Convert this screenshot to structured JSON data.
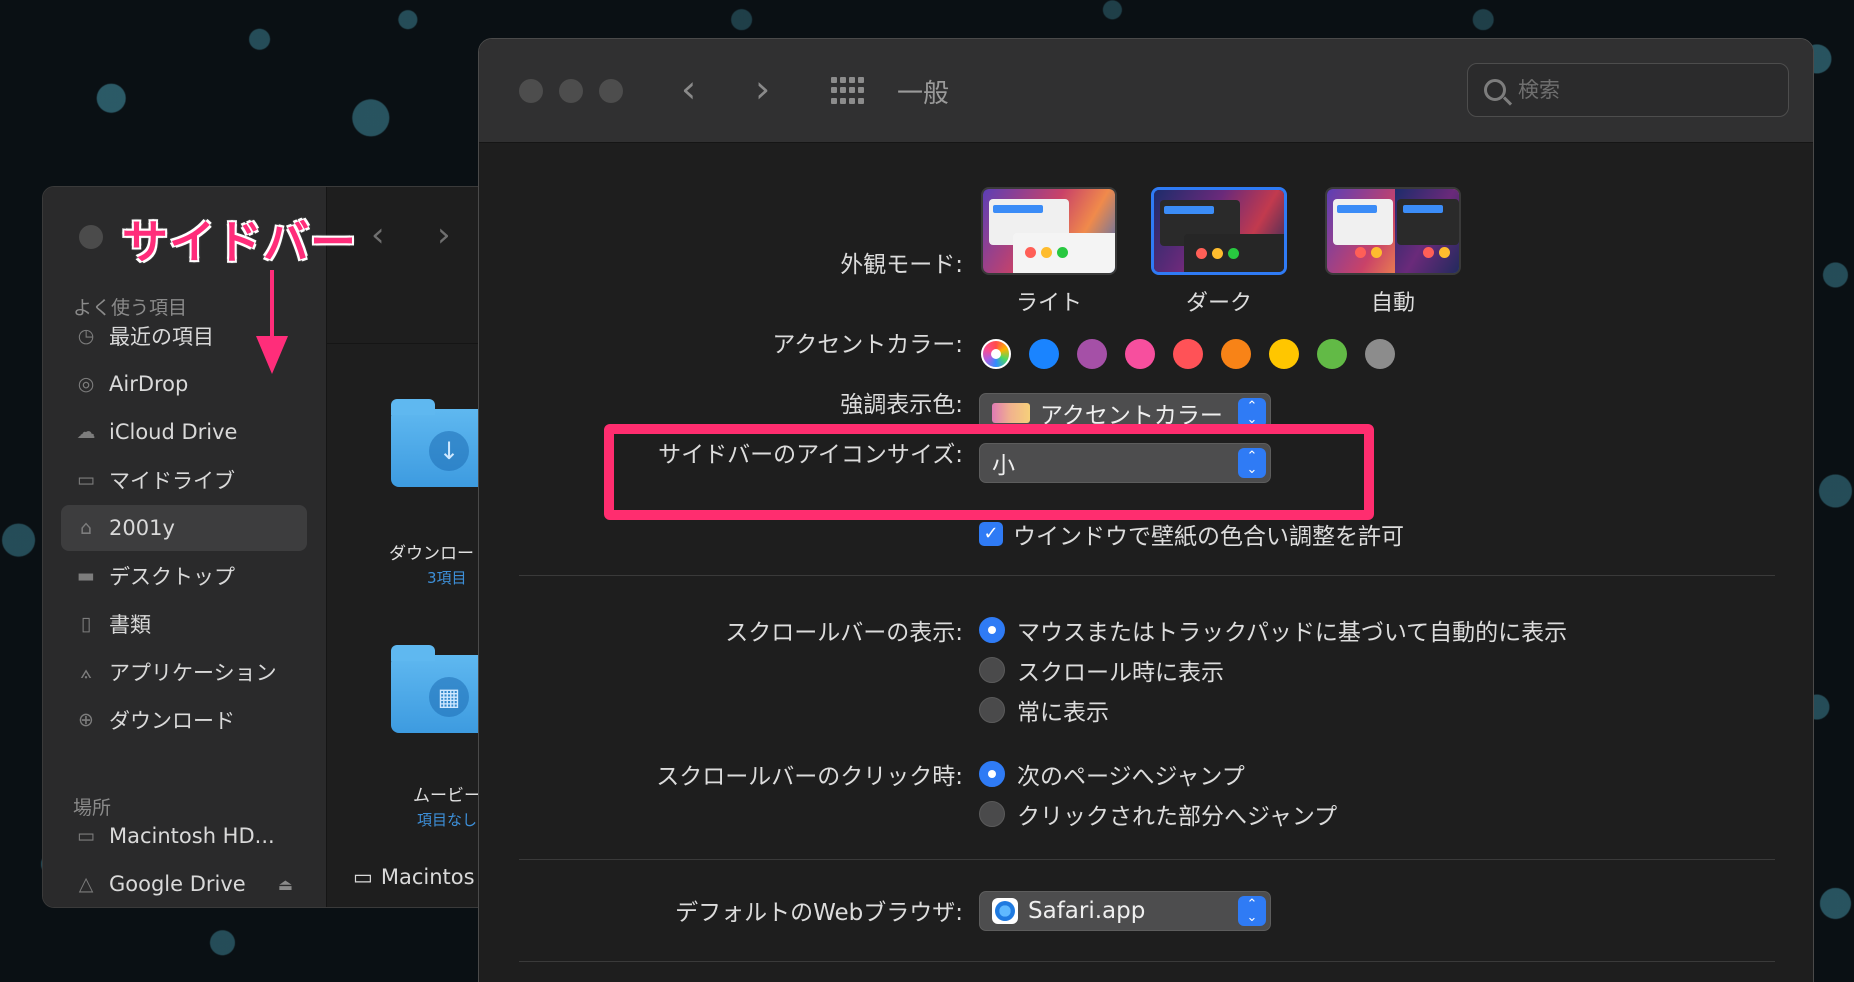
{
  "finder": {
    "sidebar": {
      "sections": {
        "favorites": "よく使う項目",
        "locations": "場所"
      },
      "items": [
        {
          "label": "最近の項目",
          "icon": "clock-icon"
        },
        {
          "label": "AirDrop",
          "icon": "airdrop-icon"
        },
        {
          "label": "iCloud Drive",
          "icon": "cloud-icon"
        },
        {
          "label": "マイドライブ",
          "icon": "folder-icon"
        },
        {
          "label": "2001y",
          "icon": "home-icon",
          "selected": true
        },
        {
          "label": "デスクトップ",
          "icon": "desktop-icon"
        },
        {
          "label": "書類",
          "icon": "document-icon"
        },
        {
          "label": "アプリケーション",
          "icon": "applications-icon"
        },
        {
          "label": "ダウンロード",
          "icon": "download-icon"
        }
      ],
      "locations": [
        {
          "label": "Macintosh HD...",
          "icon": "disk-icon"
        },
        {
          "label": "Google Drive",
          "icon": "google-drive-icon"
        }
      ]
    },
    "files": [
      {
        "name": "ダウンロー",
        "sub": "3項目"
      },
      {
        "name": "ムービー",
        "sub": "項目なし"
      }
    ],
    "path_bar": "Macintos"
  },
  "annotation": {
    "label": "サイドバー",
    "color": "#ff2d7a"
  },
  "prefs": {
    "title": "一般",
    "search_placeholder": "検索",
    "appearance": {
      "label": "外観モード:",
      "options": [
        "ライト",
        "ダーク",
        "自動"
      ],
      "selected": "ダーク"
    },
    "accent": {
      "label": "アクセントカラー:",
      "colors": [
        "multicolor",
        "#1a84ff",
        "#a550a7",
        "#f74f9e",
        "#ff5257",
        "#f88317",
        "#ffc600",
        "#62ba46",
        "#8c8c8c"
      ]
    },
    "highlight": {
      "label": "強調表示色:",
      "value": "アクセントカラー"
    },
    "sidebar_icon_size": {
      "label": "サイドバーのアイコンサイズ:",
      "value": "小"
    },
    "wallpaper_tinting": {
      "label": "ウインドウで壁紙の色合い調整を許可",
      "checked": true
    },
    "show_scroll_bars": {
      "label": "スクロールバーの表示:",
      "options": [
        "マウスまたはトラックパッドに基づいて自動的に表示",
        "スクロール時に表示",
        "常に表示"
      ],
      "selected": 0
    },
    "click_scroll_bar": {
      "label": "スクロールバーのクリック時:",
      "options": [
        "次のページへジャンプ",
        "クリックされた部分へジャンプ"
      ],
      "selected": 0
    },
    "default_browser": {
      "label": "デフォルトのWebブラウザ:",
      "value": "Safari.app"
    },
    "accent_blue": "#2f7bf5"
  }
}
